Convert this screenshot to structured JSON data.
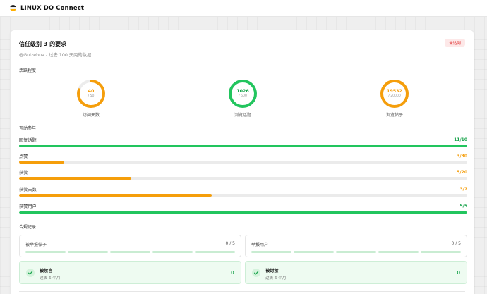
{
  "header": {
    "brand": "LINUX DO Connect"
  },
  "card": {
    "title": "信任级别 3 的要求",
    "subtitle": "@Guizehua - 过去 100 天内的数据",
    "status_badge": "未达到"
  },
  "activity": {
    "section_label": "活跃程度",
    "rings": [
      {
        "value": "40",
        "max": "/ 50",
        "label": "访问天数",
        "fraction": 0.8,
        "color": "#f59e0b"
      },
      {
        "value": "1026",
        "max": "/ 500",
        "label": "浏览话题",
        "fraction": 1.0,
        "color": "#22c55e"
      },
      {
        "value": "19532",
        "max": "/ 20000",
        "label": "浏览帖子",
        "fraction": 0.977,
        "color": "#f59e0b"
      }
    ]
  },
  "interaction": {
    "section_label": "互动参与",
    "bars": [
      {
        "label": "回复话题",
        "count": "11/10",
        "fraction": 1.0,
        "color": "#22c55e"
      },
      {
        "label": "点赞",
        "count": "3/30",
        "fraction": 0.1,
        "color": "#f59e0b"
      },
      {
        "label": "获赞",
        "count": "5/20",
        "fraction": 0.25,
        "color": "#f59e0b"
      },
      {
        "label": "获赞天数",
        "count": "3/7",
        "fraction": 0.43,
        "color": "#f59e0b"
      },
      {
        "label": "获赞用户",
        "count": "5/5",
        "fraction": 1.0,
        "color": "#22c55e"
      }
    ]
  },
  "compliance": {
    "section_label": "合规记录",
    "reported_posts": {
      "label": "被举报帖子",
      "count": "0 / 5"
    },
    "reported_users": {
      "label": "举报用户",
      "count": "0 / 5"
    },
    "silenced": {
      "label": "被禁言",
      "sub": "过去 6 个月",
      "count": "0"
    },
    "suspended": {
      "label": "被封禁",
      "sub": "过去 6 个月",
      "count": "0"
    }
  }
}
